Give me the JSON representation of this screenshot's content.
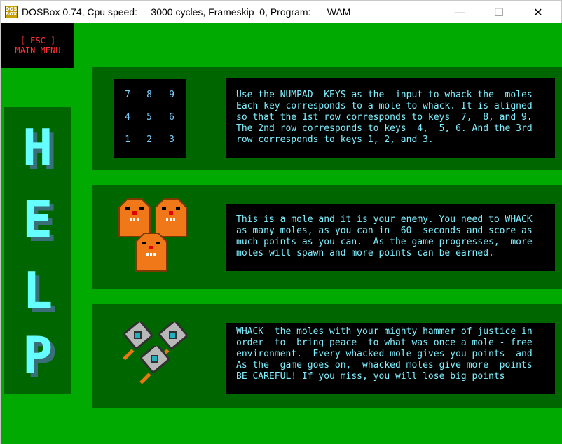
{
  "window": {
    "title": "DOSBox 0.74, Cpu speed:     3000 cycles, Frameskip  0, Program:      WAM",
    "icon_label": "DOS BOX",
    "minimize_label": "—",
    "maximize_label": "☐",
    "close_label": "✕"
  },
  "menu": {
    "esc_line1": "[ ESC ]",
    "esc_line2": "MAIN MENU"
  },
  "help": {
    "letters": [
      "H",
      "E",
      "L",
      "P"
    ]
  },
  "numpad": {
    "rows": [
      [
        "7",
        "8",
        "9"
      ],
      [
        "4",
        "5",
        "6"
      ],
      [
        "1",
        "2",
        "3"
      ]
    ]
  },
  "sections": {
    "keys_text": "Use the NUMPAD  KEYS as the  input to whack the  moles\nEach key corresponds to a mole to whack. It is aligned\nso that the 1st row corresponds to keys  7,  8, and 9.\nThe 2nd row corresponds to keys  4,  5, 6. And the 3rd\nrow corresponds to keys 1, 2, and 3.",
    "mole_text": "This is a mole and it is your enemy. You need to WHACK\nas many moles, as you can in  60  seconds and score as\nmuch points as you can.  As the game progresses,  more\nmoles will spawn and more points can be earned.",
    "hammer_text": "WHACK  the moles with your mighty hammer of justice in\norder  to  bring peace  to what was once a mole - free\nenvironment.  Every whacked mole gives you points  and\nAs the  game goes on,  whacked moles give more  points\nBE CAREFUL! If you miss, you will lose big points"
  },
  "colors": {
    "background": "#00aa00",
    "panel": "#006600",
    "text": "#7ff0ff",
    "esc": "#ff3333"
  }
}
